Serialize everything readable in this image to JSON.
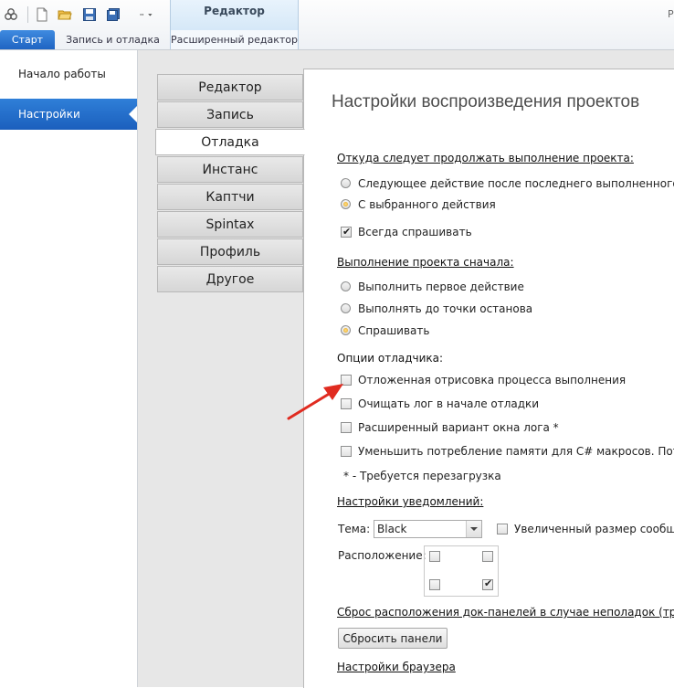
{
  "ribbon": {
    "context_tab_header": "Редактор",
    "right_text": "Pr",
    "tabs": [
      "Старт",
      "Запись и отладка",
      "Расширенный редактор"
    ],
    "quick_access_icons": [
      "logo-icon",
      "new-file-icon",
      "open-folder-icon",
      "save-icon",
      "save-all-icon",
      "more-icon"
    ]
  },
  "leftnav": {
    "items": [
      "Начало работы",
      "Настройки"
    ],
    "active": "Настройки"
  },
  "vtabs": {
    "items": [
      "Редактор",
      "Запись",
      "Отладка",
      "Инстанс",
      "Каптчи",
      "Spintax",
      "Профиль",
      "Другое"
    ],
    "active": "Отладка"
  },
  "panel": {
    "title": "Настройки воспроизведения проектов",
    "continue_section": {
      "header": "Откуда следует продолжать выполнение проекта:",
      "options": [
        "Следующее действие после последнего выполненного",
        "С выбранного действия"
      ],
      "selected_index": 1,
      "always_ask_label": "Всегда спрашивать",
      "always_ask_checked": true
    },
    "restart_section": {
      "header": "Выполнение проекта сначала:",
      "options": [
        "Выполнить первое действие",
        "Выполнять до точки останова",
        "Спрашивать"
      ],
      "selected_index": 2
    },
    "debugger_section": {
      "header": "Опции отладчика:",
      "options": [
        {
          "label": "Отложенная отрисовка процесса выполнения",
          "checked": false
        },
        {
          "label": "Очищать лог в начале отладки",
          "checked": false
        },
        {
          "label": "Расширенный вариант окна лога *",
          "checked": false
        },
        {
          "label": "Уменьшить потребление памяти для C# макросов. Потребле",
          "checked": false
        }
      ],
      "note": "* - Требуется перезагрузка"
    },
    "notifications_section": {
      "header": "Настройки уведомлений:",
      "theme_label": "Тема:",
      "theme_value": "Black",
      "big_size_label": "Увеличенный размер сообщени",
      "big_size_checked": false,
      "position_label": "Расположение:",
      "position_checked": [
        false,
        false,
        false,
        true
      ]
    },
    "reset_section": {
      "header": "Сброс расположения док-панелей в случае неполадок (требуе",
      "button_label": "Сбросить панели"
    },
    "browser_section": {
      "header": "Настройки браузера"
    },
    "annotation": {
      "color": "#e02b20",
      "icon": "red-arrow-pointer"
    }
  }
}
